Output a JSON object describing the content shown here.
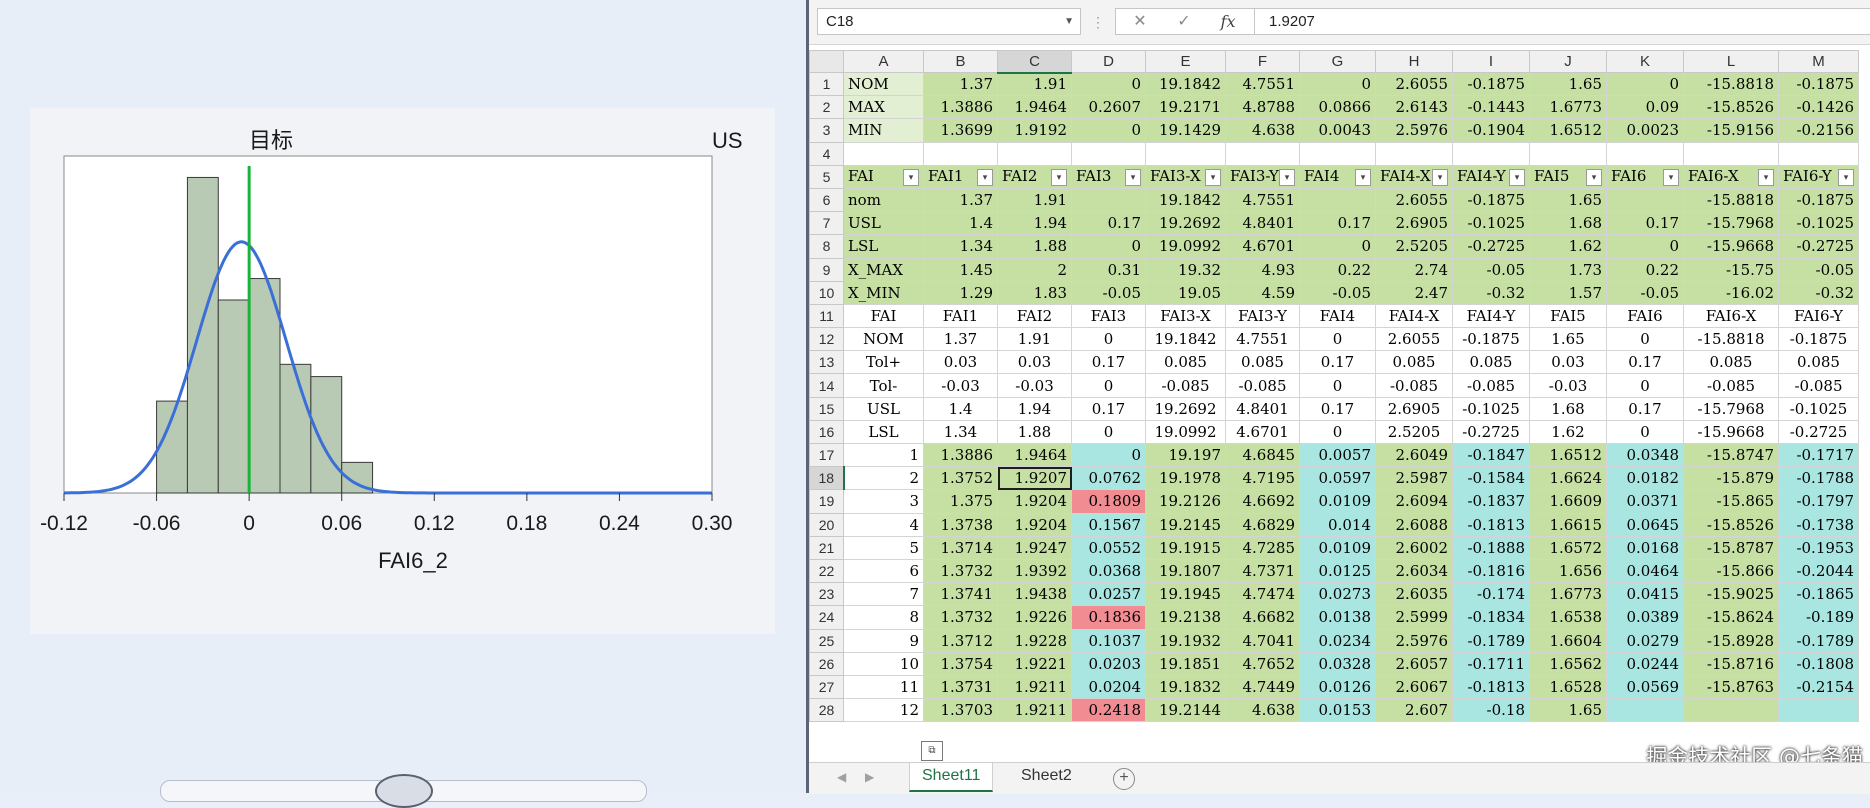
{
  "chart_data": {
    "type": "bar",
    "title": "目标",
    "title_right": "US",
    "xlabel": "FAI6_2",
    "ylabel": "",
    "x_ticks": [
      "-0.12",
      "-0.06",
      "0",
      "0.06",
      "0.12",
      "0.18",
      "0.24",
      "0.30"
    ],
    "xlim": [
      -0.12,
      0.3
    ],
    "bins": [
      {
        "x0": -0.06,
        "x1": -0.04,
        "value": 3.0
      },
      {
        "x0": -0.04,
        "x1": -0.02,
        "value": 10.3
      },
      {
        "x0": -0.02,
        "x1": 0.0,
        "value": 6.3
      },
      {
        "x0": 0.0,
        "x1": 0.02,
        "value": 7.0
      },
      {
        "x0": 0.02,
        "x1": 0.04,
        "value": 4.2
      },
      {
        "x0": 0.04,
        "x1": 0.06,
        "value": 3.8
      },
      {
        "x0": 0.06,
        "x1": 0.08,
        "value": 1.0
      }
    ],
    "ylim": [
      0,
      11
    ],
    "target_line_x": 0,
    "normal_curve": {
      "mean": -0.005,
      "sd": 0.029,
      "peak": 8.2
    },
    "colors": {
      "bar": "#b8c9b4",
      "bar_stroke": "#3a3a3a",
      "curve": "#3a6fd8",
      "target": "#19b33a"
    }
  },
  "formula_bar": {
    "cell_ref": "C18",
    "formula_value": "1.9207",
    "cancel_icon": "✕",
    "enter_icon": "✓",
    "fx_icon": "fx"
  },
  "columns": [
    "A",
    "B",
    "C",
    "D",
    "E",
    "F",
    "G",
    "H",
    "I",
    "J",
    "K",
    "L",
    "M"
  ],
  "rows": [
    [
      "NOM",
      "1.37",
      "1.91",
      "0",
      "19.1842",
      "4.7551",
      "0",
      "2.6055",
      "-0.1875",
      "1.65",
      "0",
      "-15.8818",
      "-0.1875"
    ],
    [
      "MAX",
      "1.3886",
      "1.9464",
      "0.2607",
      "19.2171",
      "4.8788",
      "0.0866",
      "2.6143",
      "-0.1443",
      "1.6773",
      "0.09",
      "-15.8526",
      "-0.1426"
    ],
    [
      "MIN",
      "1.3699",
      "1.9192",
      "0",
      "19.1429",
      "4.638",
      "0.0043",
      "2.5976",
      "-0.1904",
      "1.6512",
      "0.0023",
      "-15.9156",
      "-0.2156"
    ],
    [
      "",
      "",
      "",
      "",
      "",
      "",
      "",
      "",
      "",
      "",
      "",
      "",
      ""
    ],
    [
      "FAI",
      "FAI1",
      "FAI2",
      "FAI3",
      "FAI3-X",
      "FAI3-Y",
      "FAI4",
      "FAI4-X",
      "FAI4-Y",
      "FAI5",
      "FAI6",
      "FAI6-X",
      "FAI6-Y"
    ],
    [
      "nom",
      "1.37",
      "1.91",
      "",
      "19.1842",
      "4.7551",
      "",
      "2.6055",
      "-0.1875",
      "1.65",
      "",
      "-15.8818",
      "-0.1875"
    ],
    [
      "USL",
      "1.4",
      "1.94",
      "0.17",
      "19.2692",
      "4.8401",
      "0.17",
      "2.6905",
      "-0.1025",
      "1.68",
      "0.17",
      "-15.7968",
      "-0.1025"
    ],
    [
      "LSL",
      "1.34",
      "1.88",
      "0",
      "19.0992",
      "4.6701",
      "0",
      "2.5205",
      "-0.2725",
      "1.62",
      "0",
      "-15.9668",
      "-0.2725"
    ],
    [
      "X_MAX",
      "1.45",
      "2",
      "0.31",
      "19.32",
      "4.93",
      "0.22",
      "2.74",
      "-0.05",
      "1.73",
      "0.22",
      "-15.75",
      "-0.05"
    ],
    [
      "X_MIN",
      "1.29",
      "1.83",
      "-0.05",
      "19.05",
      "4.59",
      "-0.05",
      "2.47",
      "-0.32",
      "1.57",
      "-0.05",
      "-16.02",
      "-0.32"
    ],
    [
      "FAI",
      "FAI1",
      "FAI2",
      "FAI3",
      "FAI3-X",
      "FAI3-Y",
      "FAI4",
      "FAI4-X",
      "FAI4-Y",
      "FAI5",
      "FAI6",
      "FAI6-X",
      "FAI6-Y"
    ],
    [
      "NOM",
      "1.37",
      "1.91",
      "0",
      "19.1842",
      "4.7551",
      "0",
      "2.6055",
      "-0.1875",
      "1.65",
      "0",
      "-15.8818",
      "-0.1875"
    ],
    [
      "Tol+",
      "0.03",
      "0.03",
      "0.17",
      "0.085",
      "0.085",
      "0.17",
      "0.085",
      "0.085",
      "0.03",
      "0.17",
      "0.085",
      "0.085"
    ],
    [
      "Tol-",
      "-0.03",
      "-0.03",
      "0",
      "-0.085",
      "-0.085",
      "0",
      "-0.085",
      "-0.085",
      "-0.03",
      "0",
      "-0.085",
      "-0.085"
    ],
    [
      "USL",
      "1.4",
      "1.94",
      "0.17",
      "19.2692",
      "4.8401",
      "0.17",
      "2.6905",
      "-0.1025",
      "1.68",
      "0.17",
      "-15.7968",
      "-0.1025"
    ],
    [
      "LSL",
      "1.34",
      "1.88",
      "0",
      "19.0992",
      "4.6701",
      "0",
      "2.5205",
      "-0.2725",
      "1.62",
      "0",
      "-15.9668",
      "-0.2725"
    ],
    [
      "1",
      "1.3886",
      "1.9464",
      "0",
      "19.197",
      "4.6845",
      "0.0057",
      "2.6049",
      "-0.1847",
      "1.6512",
      "0.0348",
      "-15.8747",
      "-0.1717"
    ],
    [
      "2",
      "1.3752",
      "1.9207",
      "0.0762",
      "19.1978",
      "4.7195",
      "0.0597",
      "2.5987",
      "-0.1584",
      "1.6624",
      "0.0182",
      "-15.879",
      "-0.1788"
    ],
    [
      "3",
      "1.375",
      "1.9204",
      "0.1809",
      "19.2126",
      "4.6692",
      "0.0109",
      "2.6094",
      "-0.1837",
      "1.6609",
      "0.0371",
      "-15.865",
      "-0.1797"
    ],
    [
      "4",
      "1.3738",
      "1.9204",
      "0.1567",
      "19.2145",
      "4.6829",
      "0.014",
      "2.6088",
      "-0.1813",
      "1.6615",
      "0.0645",
      "-15.8526",
      "-0.1738"
    ],
    [
      "5",
      "1.3714",
      "1.9247",
      "0.0552",
      "19.1915",
      "4.7285",
      "0.0109",
      "2.6002",
      "-0.1888",
      "1.6572",
      "0.0168",
      "-15.8787",
      "-0.1953"
    ],
    [
      "6",
      "1.3732",
      "1.9392",
      "0.0368",
      "19.1807",
      "4.7371",
      "0.0125",
      "2.6034",
      "-0.1816",
      "1.656",
      "0.0464",
      "-15.866",
      "-0.2044"
    ],
    [
      "7",
      "1.3741",
      "1.9438",
      "0.0257",
      "19.1945",
      "4.7474",
      "0.0273",
      "2.6035",
      "-0.174",
      "1.6773",
      "0.0415",
      "-15.9025",
      "-0.1865"
    ],
    [
      "8",
      "1.3732",
      "1.9226",
      "0.1836",
      "19.2138",
      "4.6682",
      "0.0138",
      "2.5999",
      "-0.1834",
      "1.6538",
      "0.0389",
      "-15.8624",
      "-0.189"
    ],
    [
      "9",
      "1.3712",
      "1.9228",
      "0.1037",
      "19.1932",
      "4.7041",
      "0.0234",
      "2.5976",
      "-0.1789",
      "1.6604",
      "0.0279",
      "-15.8928",
      "-0.1789"
    ],
    [
      "10",
      "1.3754",
      "1.9221",
      "0.0203",
      "19.1851",
      "4.7652",
      "0.0328",
      "2.6057",
      "-0.1711",
      "1.6562",
      "0.0244",
      "-15.8716",
      "-0.1808"
    ],
    [
      "11",
      "1.3731",
      "1.9211",
      "0.0204",
      "19.1832",
      "4.7449",
      "0.0126",
      "2.6067",
      "-0.1813",
      "1.6528",
      "0.0569",
      "-15.8763",
      "-0.2154"
    ],
    [
      "12",
      "1.3703",
      "1.9211",
      "0.2418",
      "19.2144",
      "4.638",
      "0.0153",
      "2.607",
      "-0.18",
      "1.65",
      "",
      "",
      ""
    ]
  ],
  "sheet_tabs": {
    "active": "Sheet11",
    "second": "Sheet2",
    "add_icon": "+"
  },
  "watermark": "掘金技术社区 @七条猫",
  "selected_cell": "C18"
}
